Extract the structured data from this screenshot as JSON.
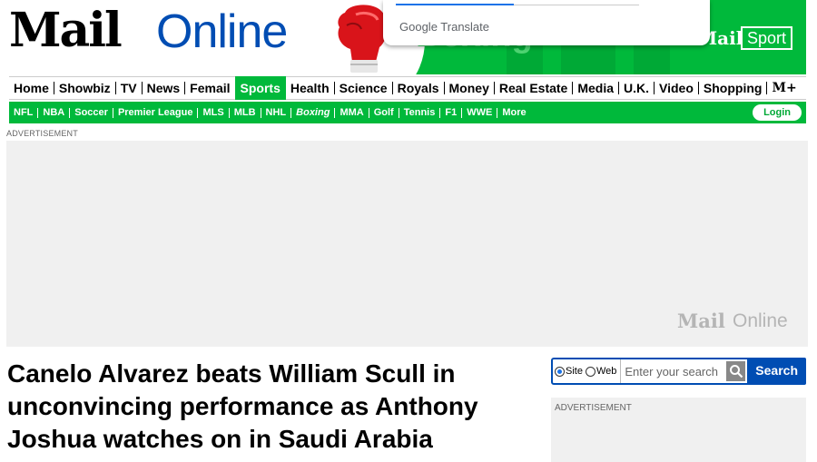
{
  "header": {
    "logo_mail": "Mail",
    "logo_online": "Online",
    "banner_text": "Boxing",
    "brand_mail": "Mail",
    "brand_sport": "Sport",
    "translate_label": "Google Translate"
  },
  "main_nav": [
    {
      "label": "Home"
    },
    {
      "label": "Showbiz"
    },
    {
      "label": "TV"
    },
    {
      "label": "News"
    },
    {
      "label": "Femail"
    },
    {
      "label": "Sports",
      "active": true
    },
    {
      "label": "Health"
    },
    {
      "label": "Science"
    },
    {
      "label": "Royals"
    },
    {
      "label": "Money"
    },
    {
      "label": "Real Estate"
    },
    {
      "label": "Media"
    },
    {
      "label": "U.K."
    },
    {
      "label": "Video"
    },
    {
      "label": "Shopping"
    },
    {
      "label": "M+"
    }
  ],
  "sub_nav": [
    {
      "label": "NFL"
    },
    {
      "label": "NBA"
    },
    {
      "label": "Soccer"
    },
    {
      "label": "Premier League"
    },
    {
      "label": "MLS"
    },
    {
      "label": "MLB"
    },
    {
      "label": "NHL"
    },
    {
      "label": "Boxing",
      "active": true
    },
    {
      "label": "MMA"
    },
    {
      "label": "Golf"
    },
    {
      "label": "Tennis"
    },
    {
      "label": "F1"
    },
    {
      "label": "WWE"
    },
    {
      "label": "More"
    }
  ],
  "login_label": "Login",
  "ad": {
    "label": "ADVERTISEMENT",
    "logo_mail": "Mail",
    "logo_online": "Online"
  },
  "article": {
    "headline": "Canelo Alvarez beats William Scull in unconvincing performance as Anthony Joshua watches on in Saudi Arabia"
  },
  "search": {
    "option_site": "Site",
    "option_web": "Web",
    "selected": "Site",
    "placeholder": "Enter your search",
    "button_label": "Search"
  },
  "side_ad": {
    "label": "ADVERTISEMENT"
  },
  "colors": {
    "brand_green": "#00b93b",
    "brand_blue": "#004db3"
  }
}
